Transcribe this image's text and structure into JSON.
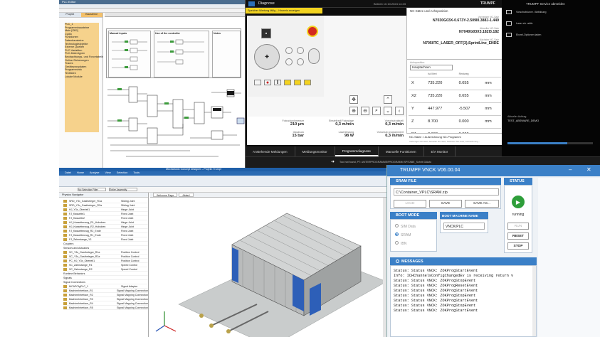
{
  "plc": {
    "title": "PLC Editor",
    "tabs": [
      "Projekt",
      "Bausteine"
    ],
    "tree": [
      "PLC_1",
      "Programmbausteine",
      "Main [OB1]",
      "Cyclic",
      "Funktionen",
      "Datenbausteine",
      "Technologieobjekte",
      "Externe Quellen",
      "PLC-Variablen",
      "PLC-Datentypen",
      "Beobachtungs- und Forcetabellen",
      "Online-Sicherungen",
      "Traces",
      "Geräteproxydaten",
      "Programminfo",
      "Textlisten",
      "Lokale Module"
    ],
    "panels": [
      "Manual inputs",
      "Use of the controller",
      "Notes"
    ]
  },
  "diag": {
    "title": "Diagnose",
    "top_center": "Betrieb  10.10.2024  14:23",
    "top_right": "TRUMPF",
    "banner": "Speicher Wartung fällig – Hinweis anzeigen",
    "nc": {
      "header": "NC-Sätze und Achsposition",
      "prev_label": "Vorheriger NC-Satz",
      "prev": "N7030G03X-0.673Y-2.509I0.388J-1.449",
      "cur_label": "Aktueller NC-Satz",
      "cur": "N7040G03X3.182I3.182",
      "next_label": "Nächster NC-Satz",
      "next": "N7050TC_LASER_OFF(3),SprintLine_ENDE"
    },
    "axes": {
      "header": "Achsposition",
      "mode": "Hauptachsen",
      "col_ist": "Ist-Wert",
      "col_rest": "Restweg",
      "rows": [
        {
          "axis": "X",
          "ist": "735.220",
          "rest": "0.655",
          "unit": "mm"
        },
        {
          "axis": "X2",
          "ist": "735.220",
          "rest": "0.655",
          "unit": "mm"
        },
        {
          "axis": "Y",
          "ist": "447.977",
          "rest": "-5.507",
          "unit": "mm"
        },
        {
          "axis": "Z",
          "ist": "8.700",
          "rest": "0.000",
          "unit": "mm"
        },
        {
          "axis": "PA",
          "ist": "0.000",
          "rest": "0.000",
          "unit": "mm"
        }
      ]
    },
    "stats": [
      {
        "label": "Fokusdurchmesser",
        "value": "210 µm"
      },
      {
        "label": "Einstellradl Fokuslage",
        "value": "0,3 m/min"
      },
      {
        "label": "Vorschub aktuell",
        "value": "0,3 m/min"
      },
      {
        "label": "Gasdruck",
        "value": "15 bar"
      },
      {
        "label": "Laserleistung",
        "value": "98 W"
      },
      {
        "label": "Vorschub programmiert",
        "value": "0,3 m/min"
      }
    ],
    "prog_note": "NC-Sätze > Aufzeichnung NC-Programm",
    "prog_sub": "Vorheriger NC-Satz, Aktueller NC-Satz, Nächster NC-Satz, Aufzeichnung...",
    "tabs": [
      "Anstehende Meldungen",
      "Meldungsmonitor",
      "Programmdiagnose",
      "Manuelle Funktionen",
      "E/A Monitor"
    ],
    "status_msg": "Tool not found, PT: UNTERPROGRAMME/PROGRAMM SPITABE_Schritt 3/Auto",
    "side": [
      "Vorschubkurve / Abbildung",
      "Laser eh. aktiv",
      "Einzel-Optionen laden"
    ],
    "side_top": "TRUMPF Service abmelden",
    "side_job_label": "Aktueller Auftrag",
    "side_job": "TEST_ABSWARE_DEMO"
  },
  "sim": {
    "title": "Mechatronic Concept Designer – Projekt: Trumpf",
    "ribbon": [
      "Datei",
      "Home",
      "Analyse",
      "View",
      "Selection",
      "Tools"
    ],
    "navigator": "Physics Navigator",
    "filter_label": "No Selection Filter",
    "assembly": "Entire Assembly",
    "tab1": "Welcome Page",
    "tab2": "Ablauf",
    "tree": [
      {
        "n": "SRD_Y3x_Gastheleger_R1a",
        "t": "Sliding Joint"
      },
      {
        "n": "SRD_Y3x_Gastheleger_R2a",
        "t": "Sliding Joint"
      },
      {
        "n": "HJ_Y3x_Oberteil1",
        "t": "Hinge Joint"
      },
      {
        "n": "FJ_Kassette1",
        "t": "Fixed Joint"
      },
      {
        "n": "FJ_Kassette2",
        "t": "Fixed Joint"
      },
      {
        "n": "HJ_Kassettenzug_R1_Huboben",
        "t": "Hinge Joint"
      },
      {
        "n": "HJ_Kassettenzug_R2_Huboben",
        "t": "Hinge Joint"
      },
      {
        "n": "FJ_Kassettenzug_R2_Ende",
        "t": "Fixed Joint"
      },
      {
        "n": "FJ_Kassettenzug_R1_Ende",
        "t": "Fixed Joint"
      },
      {
        "n": "FJ_Zahnstange_Y3",
        "t": "Fixed Joint"
      },
      {
        "n": "Couplers",
        "t": ""
      },
      {
        "n": "Sensors and Actuators",
        "t": ""
      },
      {
        "n": "SC_Y3x_Gastheleger_R1a",
        "t": "Position Control"
      },
      {
        "n": "SC_Y3x_Gastheleger_R2a",
        "t": "Position Control"
      },
      {
        "n": "PC_HJ_Y3x_Oberteil1",
        "t": "Position Control"
      },
      {
        "n": "SC_Zahnstange_R1",
        "t": "Speed Control"
      },
      {
        "n": "SC_Zahnstange_R2",
        "t": "Speed Control"
      },
      {
        "n": "Runtime Behaviors",
        "t": ""
      },
      {
        "n": "Signals",
        "t": ""
      },
      {
        "n": "Signal Connections",
        "t": ""
      },
      {
        "n": "MCAPCfgPLC_1",
        "t": "Signal Adapter"
      },
      {
        "n": "MachineInterface_R1",
        "t": "Signal Mapping Connection"
      },
      {
        "n": "MachineInterface_R2",
        "t": "Signal Mapping Connection"
      },
      {
        "n": "MachineInterface_R3",
        "t": "Signal Mapping Connection"
      },
      {
        "n": "MachineInterface_R4",
        "t": "Signal Mapping Connection"
      },
      {
        "n": "MachineInterface_R5",
        "t": "Signal Mapping Connection"
      }
    ]
  },
  "vnck": {
    "title": "TRUMPF VNCK V06.00.04",
    "sram_header": "SRAM FILE",
    "sram_path": "C:\\Container_VPLC\\SRAM.zip",
    "load": "LOAD",
    "save": "SAVE",
    "save_as": "SAVE AS...",
    "boot_header": "BOOT MODE",
    "boot_options": [
      "SIM Data",
      "SRAM",
      "IBN"
    ],
    "boot_selected": 1,
    "boot_name_header": "BOOT MACHINE NAME",
    "boot_name": "VNCK/PLC",
    "status_header": "STATUS",
    "status": "running",
    "run": "RUN",
    "reset": "RESET",
    "stop": "STOP",
    "messages_header": "MESSAGES",
    "messages": [
      "Status: Status VNCK: ZOKProgStartEvent",
      "Info: ICHChannelsConfigChangedEv is receiving return v",
      "Status: Status VNCK: ZOKProgStopEvent",
      "Status: Status VNCK: ZOKProgResetEvent",
      "Status: Status VNCK: ZOKProgStartEvent",
      "Status: Status VNCK: ZOKProgStopEvent",
      "Status: Status VNCK: ZOKProgStartEvent",
      "Status: Status VNCK: ZOKProgStopEvent",
      "Status: Status VNCK: ZOKProgStartEvent"
    ],
    "colors": {
      "accent": "#3b80c7",
      "run_green": "#2e9e3a"
    }
  }
}
